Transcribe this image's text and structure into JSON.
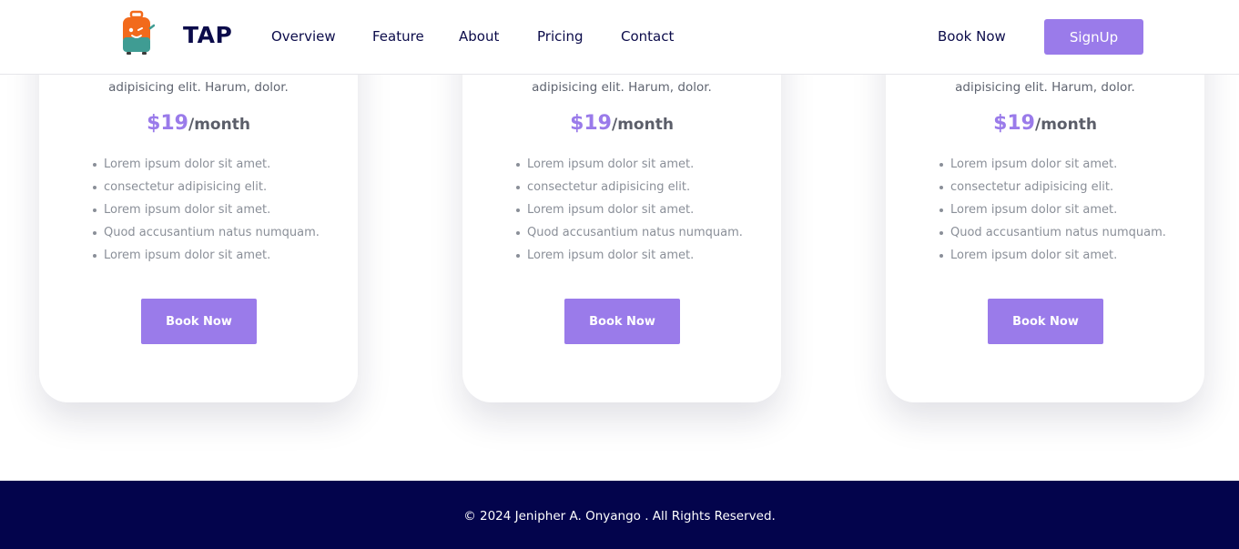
{
  "header": {
    "brand": "TAP",
    "logo_icon": "suitcase-mascot-icon",
    "nav": [
      "Overview",
      "Feature",
      "About",
      "Pricing",
      "Contact"
    ],
    "book_now_label": "Book Now",
    "signup_label": "SignUp"
  },
  "colors": {
    "accent": "#9a7bea",
    "navy": "#0b0b4a",
    "footer_bg": "#03044c"
  },
  "plans": [
    {
      "description": "adipisicing elit. Harum, dolor.",
      "price": "$19",
      "period": "/month",
      "features": [
        "Lorem ipsum dolor sit amet.",
        "consectetur adipisicing elit.",
        "Lorem ipsum dolor sit amet.",
        " Quod accusantium natus numquam.",
        "Lorem ipsum dolor sit amet."
      ],
      "button_label": "Book Now"
    },
    {
      "description": "adipisicing elit. Harum, dolor.",
      "price": "$19",
      "period": "/month",
      "features": [
        "Lorem ipsum dolor sit amet.",
        "consectetur adipisicing elit.",
        "Lorem ipsum dolor sit amet.",
        " Quod accusantium natus numquam.",
        "Lorem ipsum dolor sit amet."
      ],
      "button_label": "Book Now"
    },
    {
      "description": "adipisicing elit. Harum, dolor.",
      "price": "$19",
      "period": "/month",
      "features": [
        "Lorem ipsum dolor sit amet.",
        "consectetur adipisicing elit.",
        "Lorem ipsum dolor sit amet.",
        " Quod accusantium natus numquam.",
        "Lorem ipsum dolor sit amet."
      ],
      "button_label": "Book Now"
    }
  ],
  "footer": {
    "copyright": "© 2024 Jenipher A. Onyango . All Rights Reserved."
  }
}
